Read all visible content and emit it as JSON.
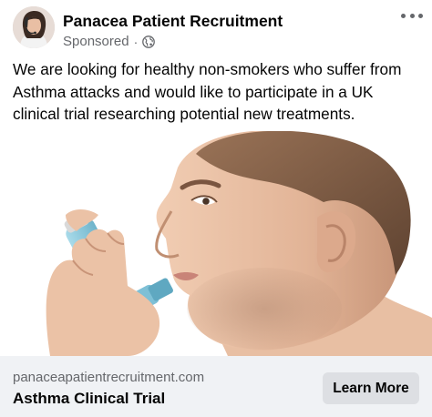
{
  "post": {
    "page_name": "Panacea Patient Recruitment",
    "sponsored_label": "Sponsored",
    "meta_separator": "·",
    "audience_icon": "globe-icon",
    "more_icon": "more-horizontal-icon",
    "caption": "We are looking for healthy non-smokers who suffer from Asthma attacks and would like to participate in a UK clinical trial researching potential new treatments."
  },
  "ad": {
    "image_subject": "photo",
    "link": {
      "domain": "panaceapatientrecruitment.com",
      "title": "Asthma Clinical Trial",
      "cta_label": "Learn More"
    }
  },
  "colors": {
    "text_primary": "#050505",
    "text_secondary": "#65676b",
    "footer_background": "#f0f2f5",
    "cta_background": "#dddfe3",
    "inhaler_blue": "#8ec9dc"
  }
}
